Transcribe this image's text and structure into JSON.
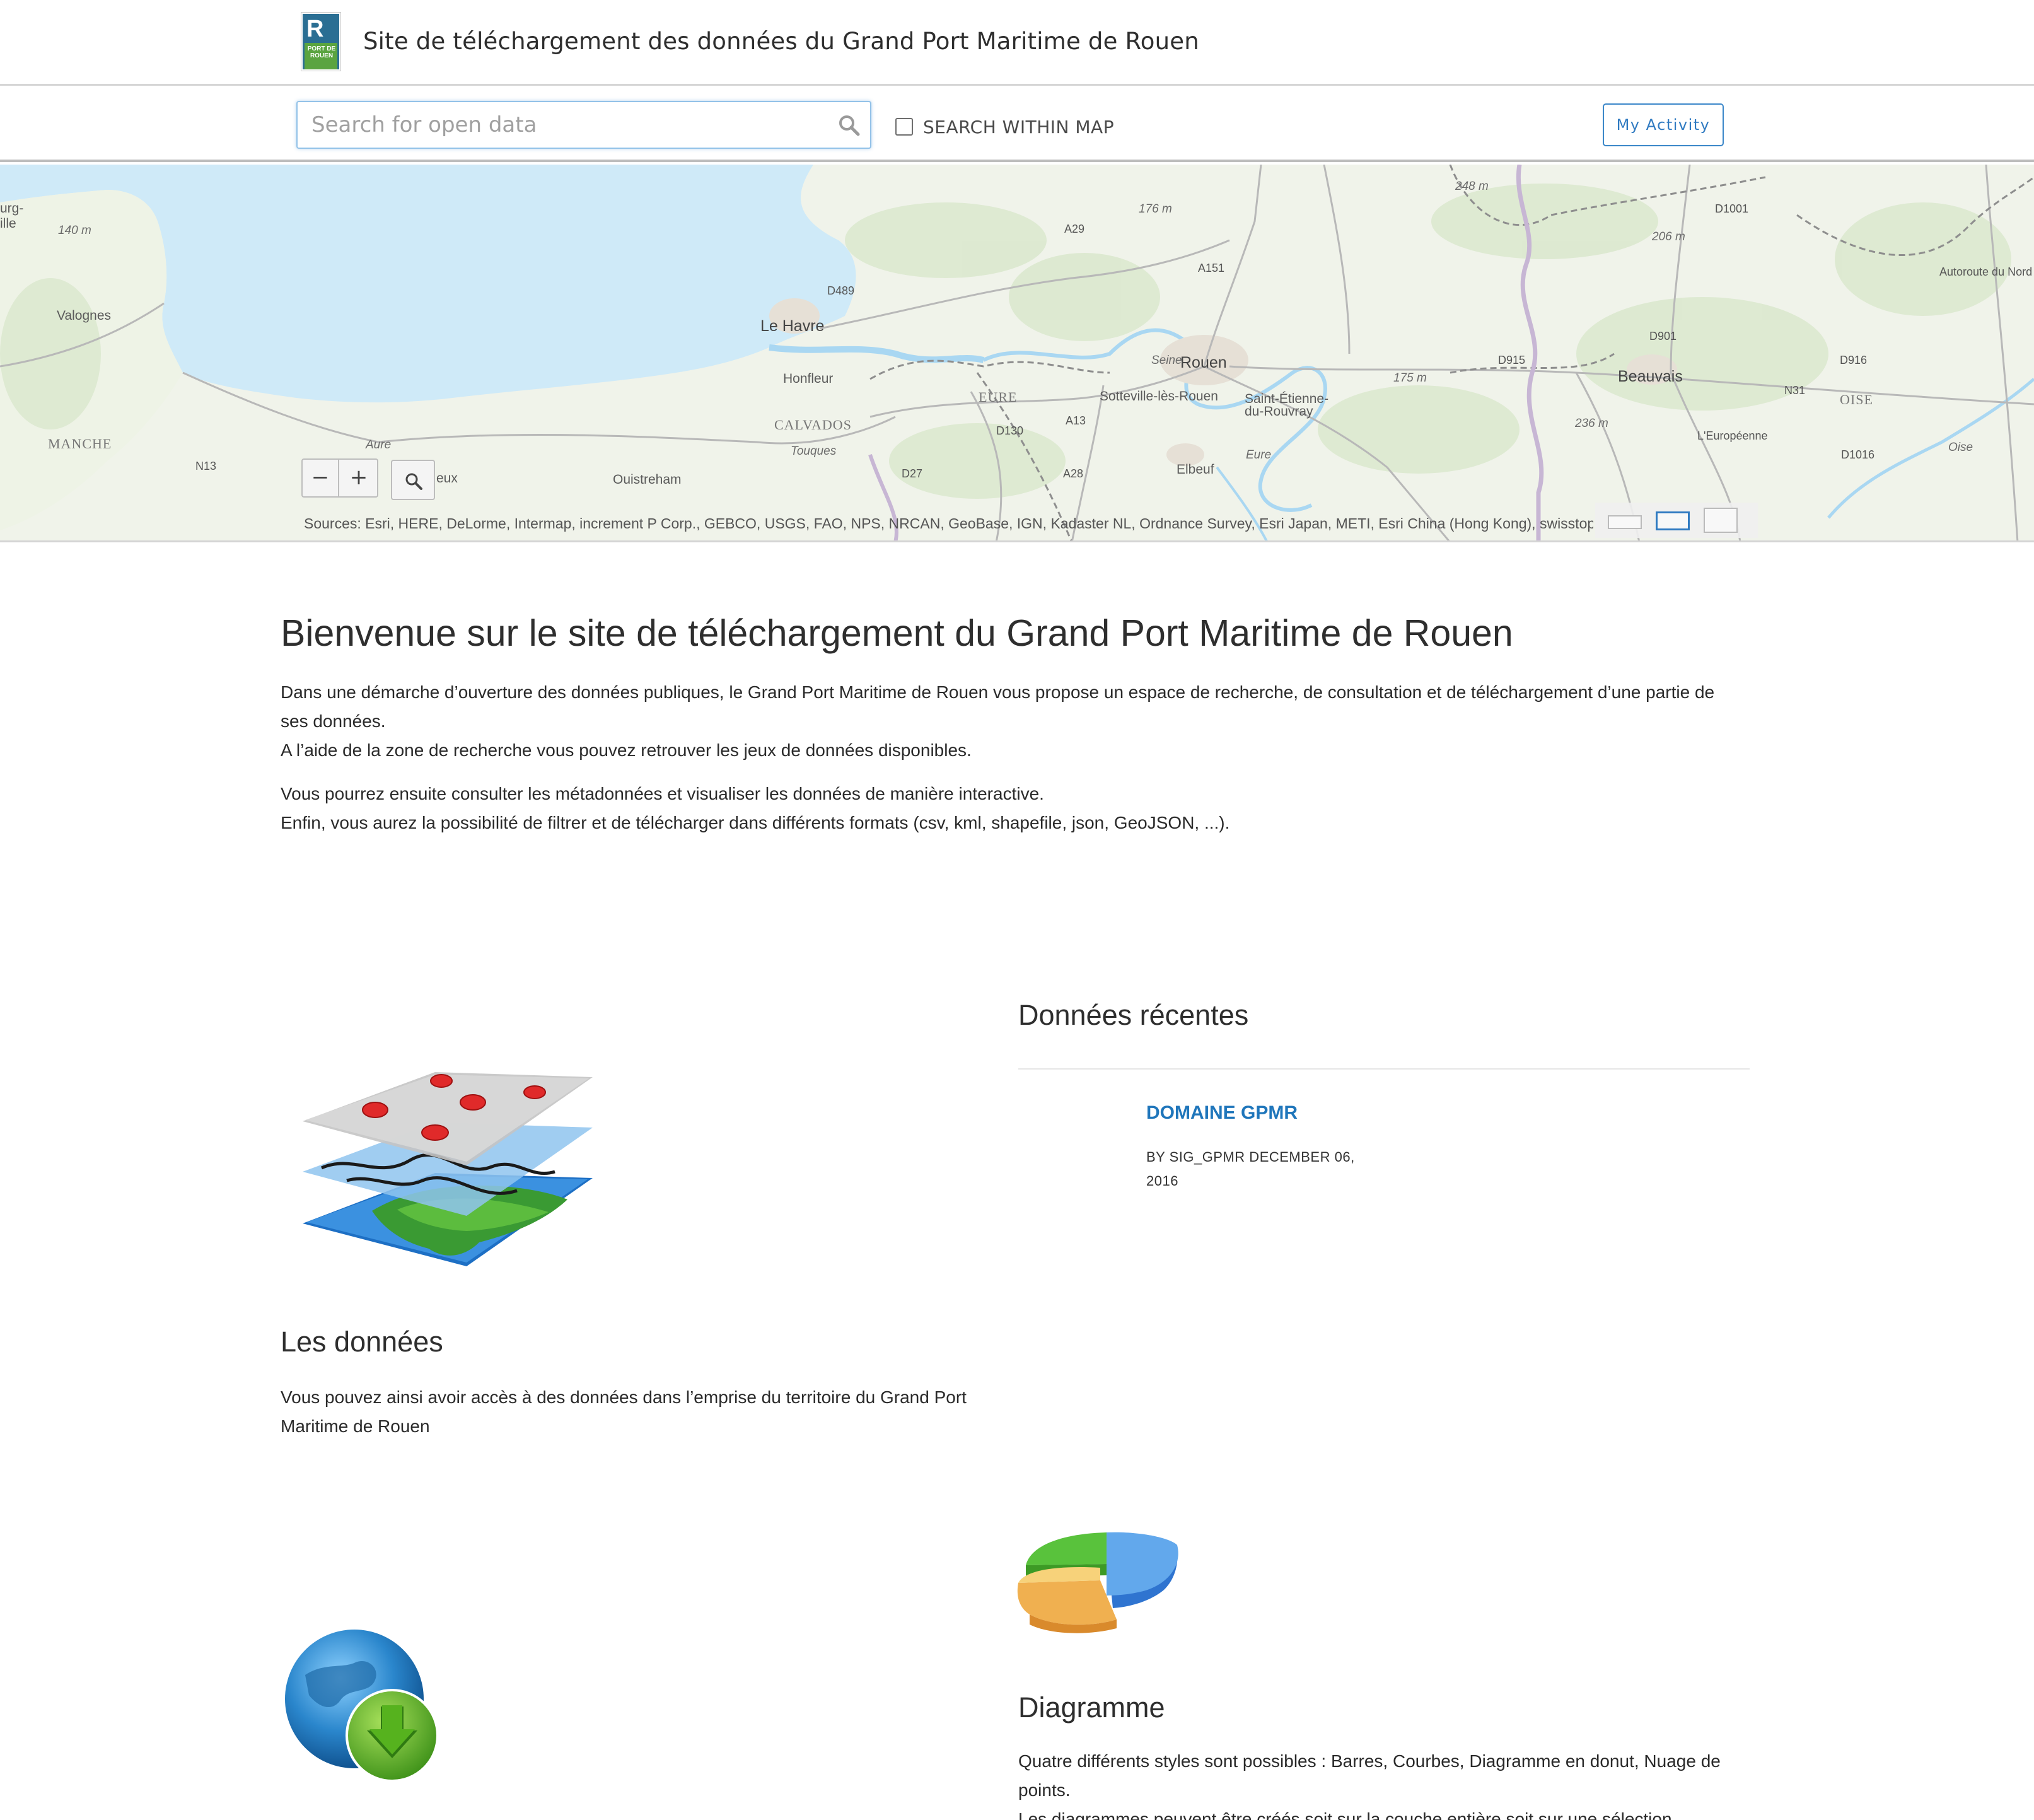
{
  "header": {
    "logo_text": "PORT DE ROUEN",
    "title": "Site de téléchargement des données du Grand Port Maritime de Rouen"
  },
  "searchbar": {
    "placeholder": "Search for open data",
    "value": "",
    "within_map_label": "SEARCH WITHIN MAP",
    "within_map_checked": false,
    "activity_button": "My Activity"
  },
  "map": {
    "places": {
      "cherbourg": "urg-\nille",
      "valognes": "Valognes",
      "manche": "MANCHE",
      "le_havre": "Le Havre",
      "honfleur": "Honfleur",
      "calvados": "CALVADOS",
      "rouen": "Rouen",
      "sotteville": "Sotteville-lès-Rouen",
      "saint_etienne": "Saint-Étienne-\ndu-Rouvray",
      "elbeuf": "Elbeuf",
      "eure": "EURE",
      "beauvais": "Beauvais",
      "oise": "OISE",
      "ouistreham": "Ouistreham",
      "bayeux": "eux",
      "aure": "Aure",
      "seine": "Seine",
      "eure_river": "Eure",
      "oise_river": "Oise",
      "touques": "Touques"
    },
    "elevations": [
      "140 m",
      "176 m",
      "248 m",
      "206 m",
      "175 m",
      "236 m"
    ],
    "roads": {
      "a29": "A29",
      "a13": "A13",
      "a151": "A151",
      "a28": "A28",
      "n31": "N31",
      "n13": "N13",
      "d489": "D489",
      "d130": "D130",
      "d27": "D27",
      "d915": "D915",
      "d901": "D901",
      "d916": "D916",
      "d1001": "D1001",
      "d1016": "D1016",
      "europeenne": "L'Européenne",
      "autoroute_nord": "Autoroute du Nord"
    },
    "zoom_out": "−",
    "zoom_in": "+",
    "attribution": "Sources: Esri, HERE, DeLorme, Intermap, increment P Corp., GEBCO, USGS, FAO, NPS, NRCAN, GeoBase, IGN, Kadaster NL, Ordnance Survey, Esri Japan, METI, Esri China (Hong Kong), swisstopo, MapmyIndia, © OpenStreetMap contributors, and the GIS User Community"
  },
  "welcome": {
    "title": "Bienvenue sur le site de téléchargement du Grand Port Maritime de Rouen",
    "para1_line1": "Dans une démarche d’ouverture des données publiques, le Grand Port Maritime de Rouen vous propose un espace de recherche, de consultation et de téléchargement d’une partie de ses données.",
    "para1_line2": "A l’aide de la zone de recherche vous pouvez retrouver les jeux de données disponibles.",
    "para2_line1": "Vous pourrez ensuite consulter les métadonnées et visualiser les données de manière interactive.",
    "para2_line2": "Enfin, vous aurez la possibilité de filtrer et de télécharger dans différents formats (csv, kml, shapefile, json, GeoJSON, ...)."
  },
  "donnees": {
    "title": "Les données",
    "text": "Vous pouvez ainsi avoir accès à des données dans l’emprise du territoire du Grand Port Maritime de Rouen"
  },
  "recent": {
    "title": "Données récentes",
    "item_title": "DOMAINE GPMR",
    "item_meta": "BY SIG_GPMR DECEMBER 06, 2016"
  },
  "diagramme": {
    "title": "Diagramme",
    "line1": "Quatre différents styles sont possibles : Barres, Courbes, Diagramme en donut, Nuage de points.",
    "line2": "Les diagrammes peuvent être créés soit sur la couche entière soit sur une sélection."
  },
  "icons": {
    "search": "search-icon",
    "map_search": "magnifier-icon",
    "layers": "map-layers-icon",
    "pie": "pie-chart-icon",
    "globe": "globe-download-icon"
  },
  "colors": {
    "accent": "#1f76bb",
    "sea": "#cfeaf8",
    "land": "#eef3e8"
  }
}
